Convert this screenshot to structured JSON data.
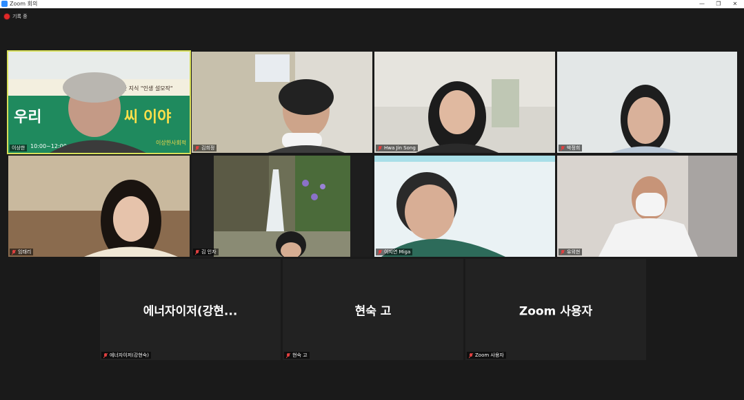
{
  "window": {
    "title": "Zoom 회의",
    "minimize": "—",
    "maximize": "❐",
    "close": "✕"
  },
  "recording": {
    "label": "기록 중",
    "color": "#e02828"
  },
  "active_speaker_color": "#d8e05a",
  "banner": {
    "line1": "다양한 지식 \"인생 설모작\"",
    "big_left": "우리",
    "big_right": "씨 이야",
    "time": "10:00~12:00",
    "org": "이상한사회적"
  },
  "participants": [
    {
      "name": "이상한",
      "muted": false,
      "active": true
    },
    {
      "name": "김희정",
      "muted": true
    },
    {
      "name": "Hwa Jin Song",
      "muted": true
    },
    {
      "name": "박정희",
      "muted": true
    },
    {
      "name": "임태리",
      "muted": true
    },
    {
      "name": "김 인자",
      "muted": true
    },
    {
      "name": "이지연 Miga",
      "muted": true
    },
    {
      "name": "유외현",
      "muted": true
    },
    {
      "name": "에너자이저(강현숙)",
      "display": "에너자이저(강현...",
      "muted": true
    },
    {
      "name": "현숙 고",
      "display": "현숙 고",
      "muted": true
    },
    {
      "name": "Zoom 사용자",
      "display": "Zoom 사용자",
      "muted": true
    }
  ]
}
